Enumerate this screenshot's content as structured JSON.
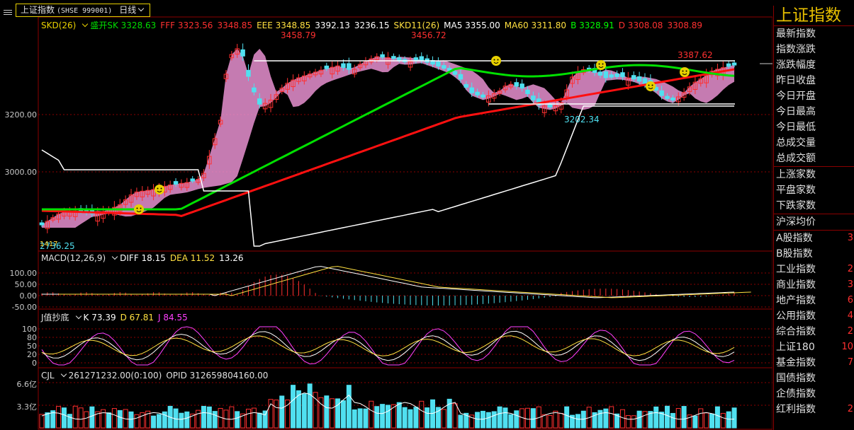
{
  "title_bar": {
    "name": "上证指数",
    "code": "(SHSE 999001)",
    "period": "日线"
  },
  "price_legend": [
    {
      "text": "SKD(26)",
      "color": "#e8d000",
      "dropdown": true
    },
    {
      "text": "盛开SK 3328.63",
      "color": "#00dd00"
    },
    {
      "text": "FFF 3323.56",
      "color": "#ff3030"
    },
    {
      "text": "3348.85",
      "color": "#ff3030"
    },
    {
      "text": "EEE 3348.85",
      "color": "#ffe040"
    },
    {
      "text": "3392.13",
      "color": "#ffffff"
    },
    {
      "text": "3236.15",
      "color": "#ffffff"
    },
    {
      "text": "SKD11(26)",
      "color": "#ffe040"
    },
    {
      "text": "MA5 3355.00",
      "color": "#ffffff"
    },
    {
      "text": "MA60 3311.80",
      "color": "#ffe040"
    },
    {
      "text": "B 3328.91",
      "color": "#00ff00"
    },
    {
      "text": "D 3308.08",
      "color": "#ff3030"
    },
    {
      "text": "3308.89",
      "color": "#ff3030"
    }
  ],
  "price_axis": [
    "3200.00",
    "3000.00"
  ],
  "price_annotations": {
    "high1": "3458.79",
    "high2": "3456.72",
    "high3": "3387.62",
    "low1": "3202.34",
    "bottom_low": "2736.25",
    "bottom_low_prefix": "1417"
  },
  "macd_legend": [
    {
      "text": "MACD(12,26,9)",
      "color": "#e0e0e0",
      "dropdown": true
    },
    {
      "text": "DIFF 18.15",
      "color": "#ffffff"
    },
    {
      "text": "DEA 11.52",
      "color": "#ffe040"
    },
    {
      "text": "13.26",
      "color": "#ffffff"
    }
  ],
  "macd_axis": [
    "100.00",
    "50.00",
    "0.00",
    "-50.00"
  ],
  "kdj_legend": [
    {
      "text": "J值抄底",
      "color": "#e0e0e0",
      "dropdown": true
    },
    {
      "text": "K 73.39",
      "color": "#ffffff"
    },
    {
      "text": "D 67.81",
      "color": "#ffe040"
    },
    {
      "text": "J 84.55",
      "color": "#ff40ff"
    }
  ],
  "kdj_axis": [
    "100",
    "80",
    "50",
    "20",
    "0"
  ],
  "vol_legend": [
    {
      "text": "CJL",
      "color": "#e0e0e0",
      "dropdown": true
    },
    {
      "text": "261271232.00(0:100)",
      "color": "#e0e0e0"
    },
    {
      "text": "OPID 312659804160.00",
      "color": "#e0e0e0"
    }
  ],
  "vol_axis": [
    "6.6亿",
    "3.3亿"
  ],
  "sidebar": {
    "title": "上证指数",
    "items": [
      {
        "label": "最新指数",
        "value": ""
      },
      {
        "label": "指数涨跌",
        "value": ""
      },
      {
        "label": "涨跌幅度",
        "value": ""
      },
      {
        "label": "昨日收盘",
        "value": ""
      },
      {
        "label": "今日开盘",
        "value": ""
      },
      {
        "label": "今日最高",
        "value": ""
      },
      {
        "label": "今日最低",
        "value": ""
      },
      {
        "label": "总成交量",
        "value": ""
      },
      {
        "label": "总成交额",
        "value": "",
        "sep_after": true
      },
      {
        "label": "上涨家数",
        "value": ""
      },
      {
        "label": "平盘家数",
        "value": ""
      },
      {
        "label": "下跌家数",
        "value": "",
        "sep_after": true
      },
      {
        "label": "沪深均价",
        "value": "",
        "sep_after": true
      },
      {
        "label": "A股指数",
        "value": "3"
      },
      {
        "label": "B股指数",
        "value": ""
      },
      {
        "label": "工业指数",
        "value": "2"
      },
      {
        "label": "商业指数",
        "value": "3"
      },
      {
        "label": "地产指数",
        "value": "6"
      },
      {
        "label": "公用指数",
        "value": "4"
      },
      {
        "label": "综合指数",
        "value": "2"
      },
      {
        "label": "上证180",
        "value": "10"
      },
      {
        "label": "基金指数",
        "value": "7"
      },
      {
        "label": "国债指数",
        "value": ""
      },
      {
        "label": "企债指数",
        "value": ""
      },
      {
        "label": "红利指数",
        "value": "2"
      }
    ]
  },
  "colors": {
    "up": "#ff3030",
    "down": "#50e0f0",
    "grid": "#8b0000",
    "ma_red": "#ff1010",
    "ma_green": "#00e000",
    "band_fill": "#e890d0"
  }
}
